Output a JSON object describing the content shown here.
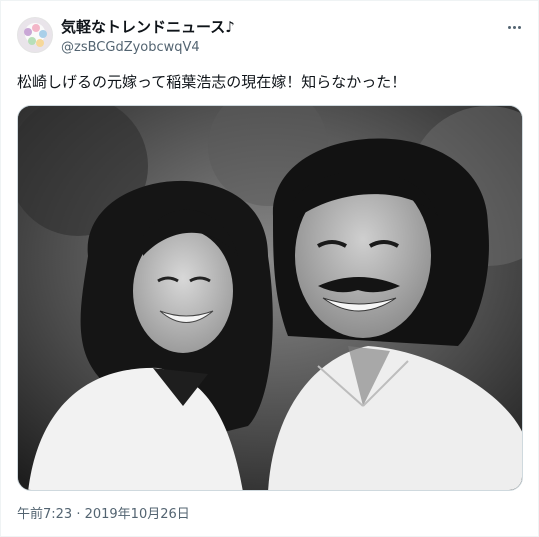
{
  "tweet": {
    "display_name": "気軽なトレンドニュース♪",
    "handle": "@zsBCGdZyobcwqV4",
    "text": "松崎しげるの元嫁って稲葉浩志の現在嫁！知らなかった！",
    "timestamp": "午前7:23 · 2019年10月26日",
    "avatar_icon": "avatar-balls-icon",
    "more_icon": "more-options-icon",
    "photo": "black-and-white photo of a smiling woman and a man with a mustache"
  },
  "colors": {
    "text": "#0f1419",
    "secondary": "#536471",
    "border": "#cfd9de"
  }
}
